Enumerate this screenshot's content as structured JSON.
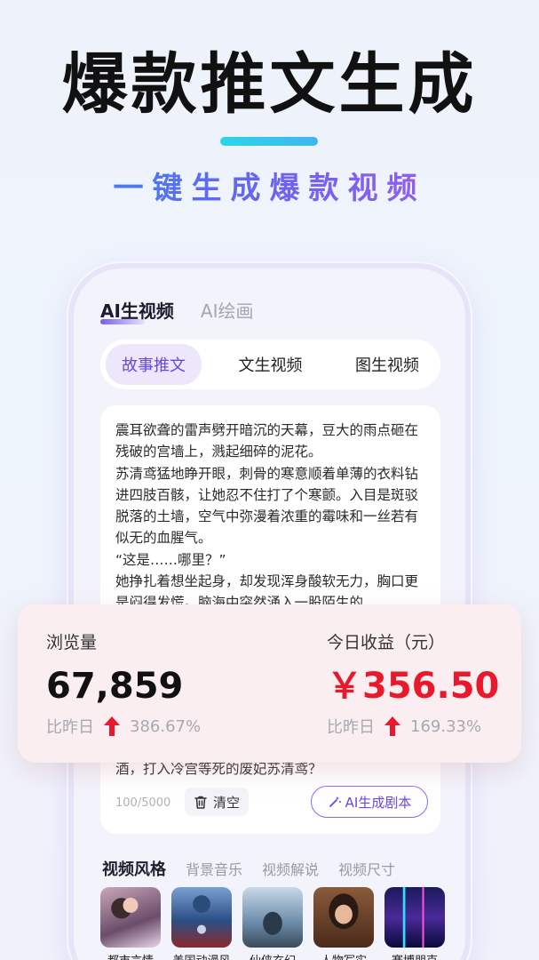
{
  "hero": {
    "title": "爆款推文生成",
    "subtitle": "一键生成爆款视频"
  },
  "app": {
    "top_tabs": [
      {
        "label": "AI生视频",
        "active": true
      },
      {
        "label": "AI绘画",
        "active": false
      }
    ],
    "segments": [
      {
        "label": "故事推文",
        "active": true
      },
      {
        "label": "文生视频",
        "active": false
      },
      {
        "label": "图生视频",
        "active": false
      }
    ],
    "editor": {
      "text": "震耳欲聋的雷声劈开暗沉的天幕，豆大的雨点砸在残破的宫墙上，溅起细碎的泥花。\n苏清鸢猛地睁开眼，刺骨的寒意顺着单薄的衣料钻进四肢百骸，让她忍不住打了个寒颤。入目是斑驳脱落的土墙，空气中弥漫着浓重的霉味和一丝若有似无的血腥气。\n“这是……哪里？”\n她挣扎着想坐起身，却发现浑身酸软无力，胸口更是闷得发慌。脑海中突然涌入一股陌生的",
      "tail_text": "酒，打入冷宫等死的废妃苏清鸢？",
      "count": "100",
      "max": "/5000",
      "clear_label": "清空",
      "generate_label": "AI生成剧本"
    },
    "style_tabs": [
      {
        "label": "视频风格",
        "active": true
      },
      {
        "label": "背景音乐",
        "active": false
      },
      {
        "label": "视频解说",
        "active": false
      },
      {
        "label": "视频尺寸",
        "active": false
      }
    ],
    "styles": [
      {
        "label": "都市言情"
      },
      {
        "label": "美国动漫风"
      },
      {
        "label": "仙侠玄幻"
      },
      {
        "label": "人物写实"
      },
      {
        "label": "赛博朋克"
      }
    ]
  },
  "stats": {
    "views": {
      "label": "浏览量",
      "value": "67,859",
      "compare_label": "比昨日",
      "change": "386.67%"
    },
    "earnings": {
      "label": "今日收益（元）",
      "value": "￥356.50",
      "compare_label": "比昨日",
      "change": "169.33%"
    }
  },
  "colors": {
    "accent_purple": "#6a48d8",
    "earnings_red": "#e8192c",
    "arrow_red": "#e8192c",
    "underline_cyan": "#2cd5e6"
  }
}
